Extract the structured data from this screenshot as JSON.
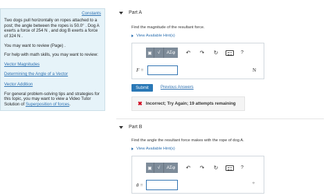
{
  "info": {
    "constants_link": "Constants",
    "problem_text": "Two dogs pull horizontally on ropes attached to a post; the angle between the ropes is 50.0° . Dog A exerts a force of 254 N , and dog B exerts a force of 324 N .",
    "review_text": "You may want to review (Page) .",
    "help_text": "For help with math skills, you may want to review:",
    "links": [
      "Vector Magnitudes",
      "Determining the Angle of a Vector",
      "Vector Addition"
    ],
    "tips_text": "For general problem-solving tips and strategies for this topic, you may want to view a Video Tutor Solution of ",
    "tips_link": "Superposition of forces",
    "tips_end": "."
  },
  "part_a": {
    "title": "Part A",
    "prompt": "Find the magnitude of the resultant force.",
    "hints": "View Available Hint(s)",
    "var_label": "F =",
    "unit": "N",
    "submit_label": "Submit",
    "previous_answers_label": "Previous Answers",
    "feedback_text": "Incorrect; Try Again; 19 attempts remaining"
  },
  "part_b": {
    "title": "Part B",
    "prompt": "Find the angle the resultant force makes with the rope of dog A.",
    "hints": "View Available Hint(s)",
    "var_label": "θ =",
    "unit": "°"
  },
  "toolbar": {
    "sqrt_glyph": "√",
    "frac_glyph": "⎕",
    "greek_label": "AΣφ",
    "undo_glyph": "↶",
    "redo_glyph": "↷",
    "reset_glyph": "↻",
    "help_glyph": "?"
  },
  "colors": {
    "link": "#2a6fb0",
    "panel_bg": "#e6f3f9",
    "submit": "#2a78b6",
    "error": "#d0021b"
  }
}
